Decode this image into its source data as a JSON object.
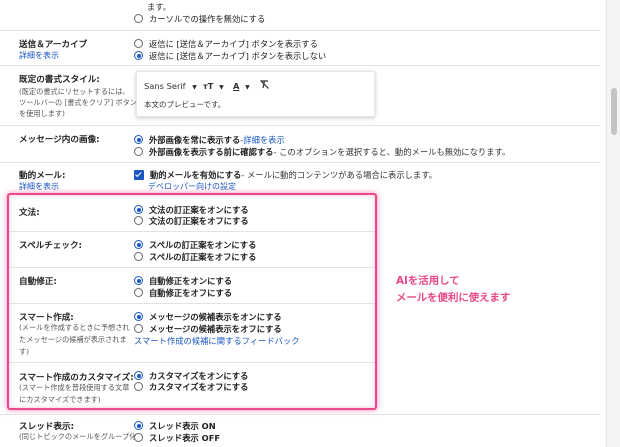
{
  "top": {
    "line1": "ます。",
    "line2": "カーソルでの操作を無効にする"
  },
  "send_archive": {
    "label": "送信＆アーカイブ",
    "link": "詳細を表示",
    "options": [
      "返信に [送信＆アーカイブ] ボタンを表示する",
      "返信に [送信＆アーカイブ] ボタンを表示しない"
    ],
    "selected": 1
  },
  "default_style": {
    "label": "既定の書式スタイル:",
    "desc": [
      "(既定の書式にリセットするには、",
      "ツールバーの [書式をクリア] ボタン",
      "を使用します)"
    ],
    "font": "Sans Serif",
    "size_icon": "ᴛT",
    "color_icon": "A",
    "preview": "本文のプレビューです。"
  },
  "images": {
    "label": "メッセージ内の画像:",
    "opt1_bold": "外部画像を常に表示する",
    "opt1_sep": " - ",
    "opt1_link": "詳細を表示",
    "opt2_bold": "外部画像を表示する前に確認する",
    "opt2_rest": " - このオプションを選択すると、動的メールも無効になります。"
  },
  "dynamic": {
    "label": "動的メール:",
    "link": "詳細を表示",
    "opt_bold": "動的メールを有効にする",
    "opt_rest": " - メールに動的コンテンツがある場合に表示します。",
    "dev_link": "デベロッパー向けの設定"
  },
  "grammar": {
    "label": "文法:",
    "options": [
      "文法の訂正案をオンにする",
      "文法の訂正案をオフにする"
    ],
    "selected": 0
  },
  "spell": {
    "label": "スペルチェック:",
    "options": [
      "スペルの訂正案をオンにする",
      "スペルの訂正案をオフにする"
    ],
    "selected": 0
  },
  "autocorrect": {
    "label": "自動修正:",
    "options": [
      "自動修正をオンにする",
      "自動修正をオフにする"
    ],
    "selected": 0
  },
  "smart_compose": {
    "label": "スマート作成:",
    "desc": [
      "(メールを作成するときに予想され",
      "たメッセージの候補が表示されま",
      "す)"
    ],
    "options": [
      "メッセージの候補表示をオンにする",
      "メッセージの候補表示をオフにする"
    ],
    "selected": 0,
    "feedback_link": "スマート作成の候補に関するフィードバック"
  },
  "smart_personal": {
    "label": "スマート作成のカスタマイズ:",
    "desc": [
      "(スマート作成を普段使用する文章",
      "にカスタマイズできます)"
    ],
    "options": [
      "カスタマイズをオンにする",
      "カスタマイズをオフにする"
    ],
    "selected": 0
  },
  "thread": {
    "label": "スレッド表示:",
    "desc": [
      "(同じトピックのメールをグループ化"
    ],
    "options": [
      "スレッド表示 ON",
      "スレッド表示 OFF"
    ],
    "selected": 0
  },
  "callout": {
    "line1": "AIを活用して",
    "line2": "メールを便利に使えます"
  },
  "colors": {
    "accent": "#1a56c4",
    "highlight": "#ea4a8c",
    "callout": "#e84888"
  }
}
